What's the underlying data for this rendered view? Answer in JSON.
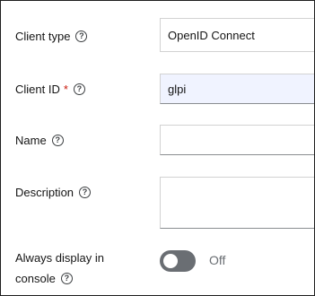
{
  "form": {
    "client_type": {
      "label": "Client type",
      "value": "OpenID Connect"
    },
    "client_id": {
      "label": "Client ID",
      "required_mark": "*",
      "value": "glpi"
    },
    "name": {
      "label": "Name",
      "value": ""
    },
    "description": {
      "label": "Description",
      "value": ""
    },
    "always_display": {
      "label_line1": "Always display in",
      "label_line2": "console",
      "state": "Off",
      "enabled": false
    }
  },
  "icons": {
    "help": "?"
  },
  "colors": {
    "required": "#c9190b",
    "toggle_off": "#6a6e73",
    "field_filled_bg": "#f0f3ff"
  }
}
